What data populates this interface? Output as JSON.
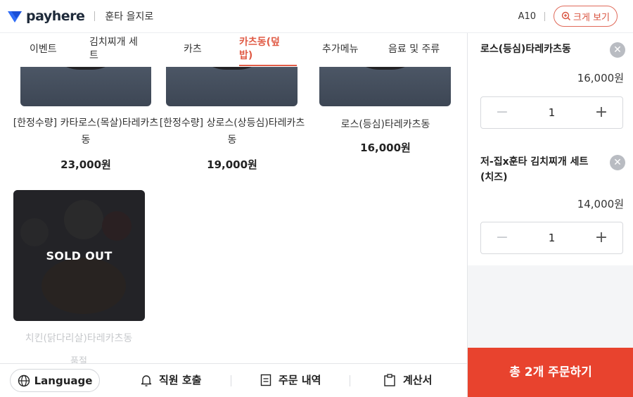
{
  "header": {
    "brand": "payhere",
    "store_name": "훈타 을지로",
    "table_no": "A10",
    "zoom_label": "크게 보기"
  },
  "tabs": [
    {
      "label": "이벤트"
    },
    {
      "label": "김치찌개 세트"
    },
    {
      "label": "카츠"
    },
    {
      "label": "카츠동(덮밥)",
      "active": true
    },
    {
      "label": "추가메뉴"
    },
    {
      "label": "음료 및 주류"
    }
  ],
  "menu": {
    "items": [
      {
        "name": "[한정수량] 카타로스(목살)타레카츠동",
        "price": "23,000원"
      },
      {
        "name": "[한정수량] 상로스(상등심)타레카츠동",
        "price": "19,000원"
      },
      {
        "name": "로스(등심)타레카츠동",
        "price": "16,000원"
      },
      {
        "name": "치킨(닭다리살)타레카츠동",
        "sub": "품절",
        "soldout_label": "SOLD OUT"
      }
    ]
  },
  "cart": {
    "items": [
      {
        "name": "로스(등심)타레카츠동",
        "price": "16,000원",
        "qty": "1"
      },
      {
        "name": "저-집x훈타 김치찌개 세트(치즈)",
        "price": "14,000원",
        "qty": "1"
      }
    ],
    "order_label": "총 2개 주문하기"
  },
  "bottom": {
    "language": "Language",
    "call_staff": "직원 호출",
    "order_history": "주문 내역",
    "bill": "계산서"
  },
  "colors": {
    "accent": "#e05b46",
    "order_button": "#e8432e",
    "brand_blue": "#2f6cf6"
  }
}
